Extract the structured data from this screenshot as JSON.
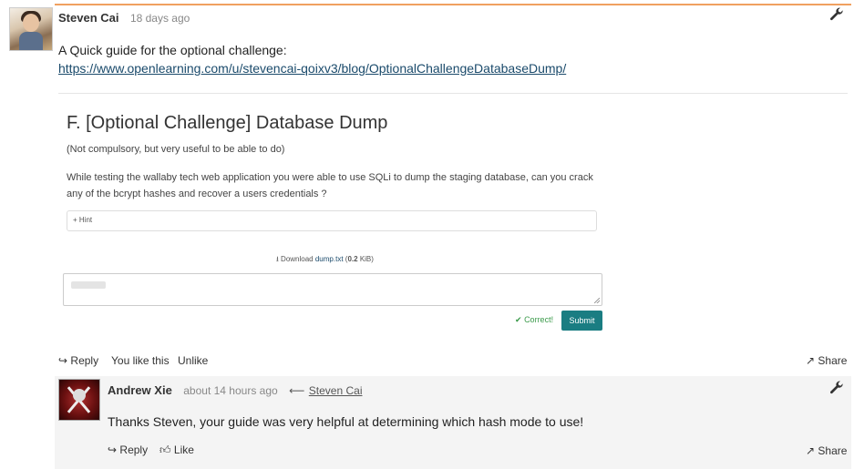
{
  "post": {
    "author": "Steven Cai",
    "time": "18 days ago",
    "text": "A Quick guide for the optional challenge:",
    "link": "https://www.openlearning.com/u/stevencai-qoixv3/blog/OptionalChallengeDatabaseDump/"
  },
  "challenge": {
    "title": "F. [Optional Challenge] Database Dump",
    "note": "(Not compulsory, but very useful to be able to do)",
    "description": "While testing the wallaby tech web application you were able to use SQLi to dump the staging database, can you crack any of the bcrypt hashes and recover a users credentials ?",
    "hint_label": "Hint",
    "download_prefix": "Download",
    "download_file": "dump.txt",
    "download_size_open": "(",
    "download_size": "0.2",
    "download_size_unit": "KiB)",
    "status": "Correct!",
    "submit_label": "Submit"
  },
  "post_actions": {
    "reply": "Reply",
    "liked": "You like this",
    "unlike": "Unlike",
    "share": "Share"
  },
  "reply": {
    "author": "Andrew Xie",
    "time": "about 14 hours ago",
    "reply_to": "Steven Cai",
    "text": "Thanks Steven, your guide was very helpful at determining which hash mode to use!",
    "reply_label": "Reply",
    "like_label": "Like",
    "share_label": "Share"
  },
  "colors": {
    "accent_line": "#f0a060",
    "submit_bg": "#1a7d82",
    "correct": "#3a9a4a",
    "link": "#1a4a6b"
  }
}
